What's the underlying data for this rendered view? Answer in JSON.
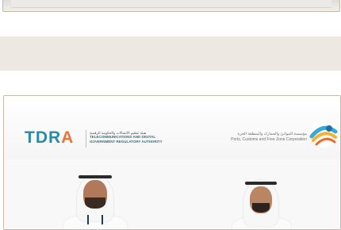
{
  "top_card": {},
  "photo": {
    "tdra": {
      "logo_text_main": "TDR",
      "logo_text_accent": "A",
      "arabic_name": "هيئة تنظيم الاتصالات والحكومة الرقمية",
      "english_line1": "TELECOMMUNICATIONS AND DIGITAL",
      "english_line2": "GOVERNMENT REGULATORY AUTHORITY"
    },
    "pcfc": {
      "arabic_name": "مؤسسة الموانئ والجمارك والمنطقة الحرة",
      "english_name": "Ports, Customs and Free Zone Corporation",
      "logo_icon": "pcfc-logo-icon"
    }
  },
  "colors": {
    "tdra_blue": "#2c8aa5",
    "tdra_orange": "#e8743b",
    "beige": "#ede8e1",
    "card_border": "#c9b9a9"
  }
}
